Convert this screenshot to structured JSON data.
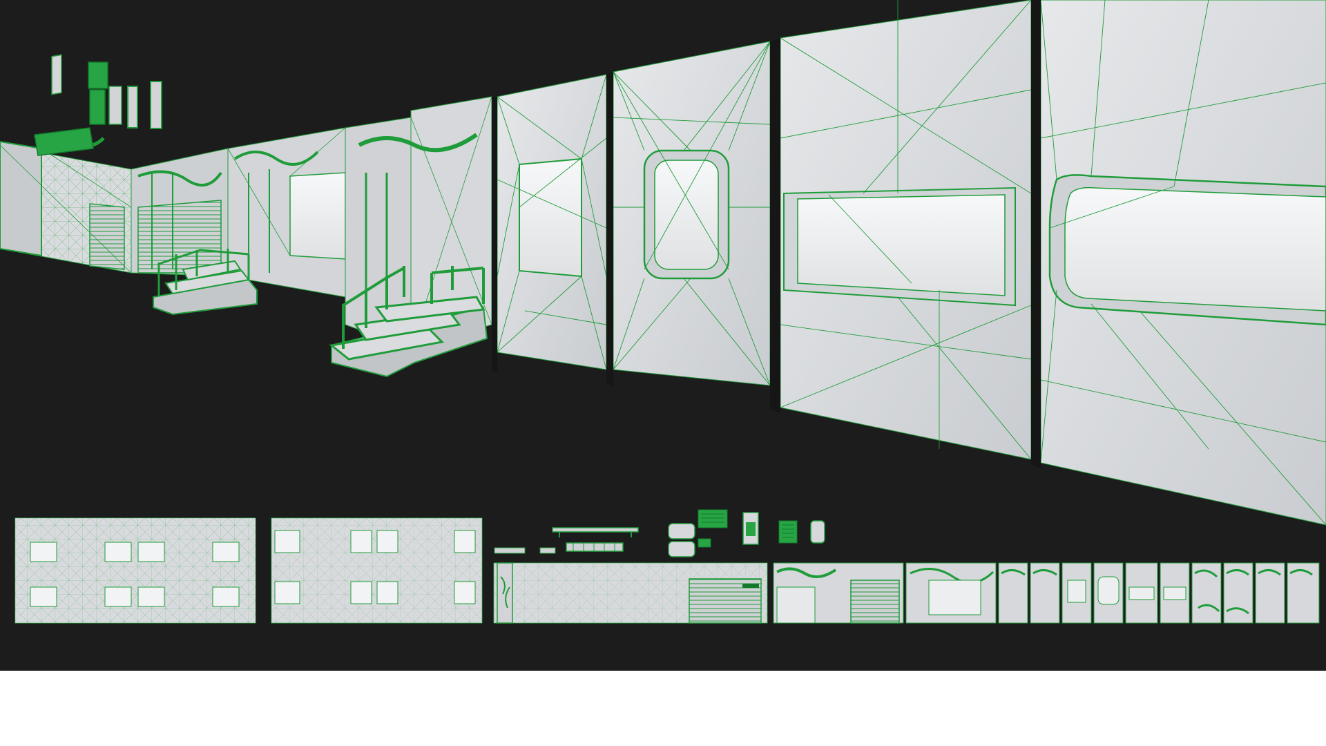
{
  "scene": {
    "kind": "3d-wireframe-viewport",
    "colors": {
      "background": "#1c1c1c",
      "below_area": "#ffffff",
      "wire": "#1f9c3a",
      "wire_dark": "#127a2a",
      "panel_fill": "#d7d9dc",
      "panel_light": "#eceeef",
      "panel_shade": "#b9bcc0",
      "gap": "#161616"
    },
    "objects": {
      "far_wall": "building-facade-strip",
      "near_panels": [
        "wall-panel-window-small",
        "wall-panel-porthole",
        "wall-panel-window-wide",
        "wall-panel-window-rounded"
      ],
      "props": [
        "staircase-railing",
        "staircase-railing",
        "pipes-cluster",
        "floating-signs"
      ],
      "lower_tiles": [
        "facade-tile-1",
        "facade-tile-2",
        "trim-strip",
        "props-row",
        "tile-set-row"
      ]
    }
  }
}
